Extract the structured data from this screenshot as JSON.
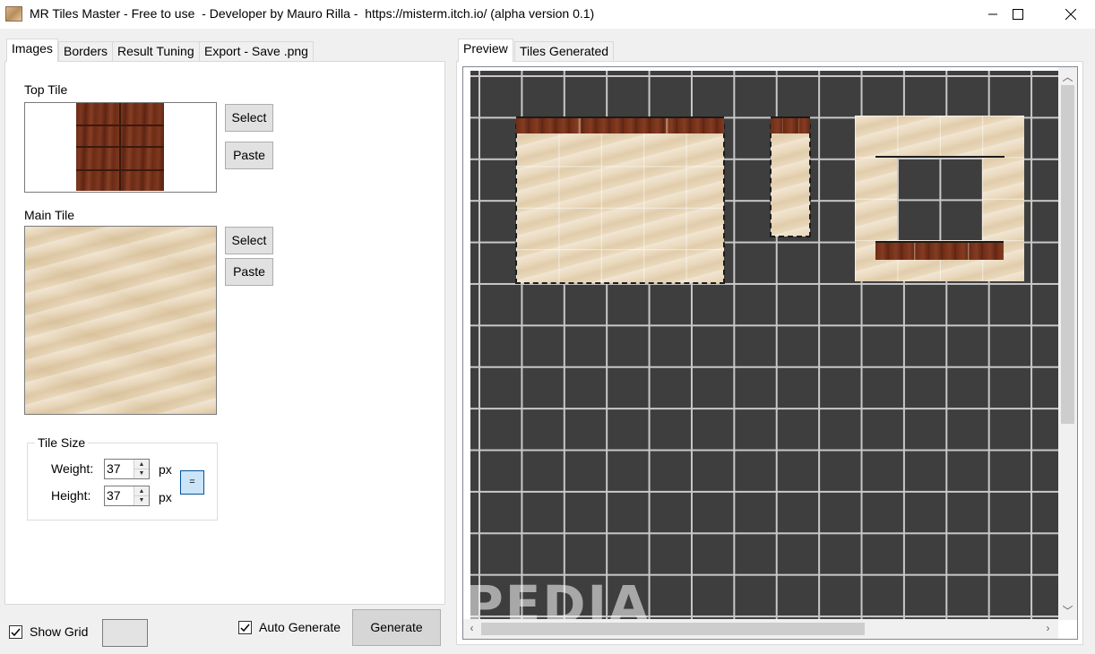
{
  "window": {
    "title": "MR Tiles Master - Free to use  - Developer by Mauro Rilla -  https://misterm.itch.io/ (alpha version 0.1)",
    "controls": {
      "minimize": "minimize-icon",
      "maximize": "maximize-icon",
      "close": "close-icon"
    }
  },
  "left_tabs": [
    "Images",
    "Borders",
    "Result Tuning",
    "Export - Save .png"
  ],
  "left_tabs_active": "Images",
  "images": {
    "top_tile_label": "Top Tile",
    "main_tile_label": "Main Tile",
    "select_label": "Select",
    "paste_label": "Paste"
  },
  "tile_size": {
    "legend": "Tile Size",
    "weight_label": "Weight:",
    "weight_value": "37",
    "height_label": "Height:",
    "height_value": "37",
    "unit": "px",
    "equal_label": "="
  },
  "bottom": {
    "show_grid_label": "Show Grid",
    "show_grid_checked": true,
    "auto_generate_label": "Auto Generate",
    "auto_generate_checked": true,
    "generate_label": "Generate"
  },
  "right_tabs": [
    "Preview",
    "Tiles Generated"
  ],
  "right_tabs_active": "Preview",
  "watermark": "SOFTPEDIA",
  "colors": {
    "canvas_bg": "#3e3e3e",
    "grid_line": "#c8c8c8",
    "equal_button": "#cce4f7"
  }
}
